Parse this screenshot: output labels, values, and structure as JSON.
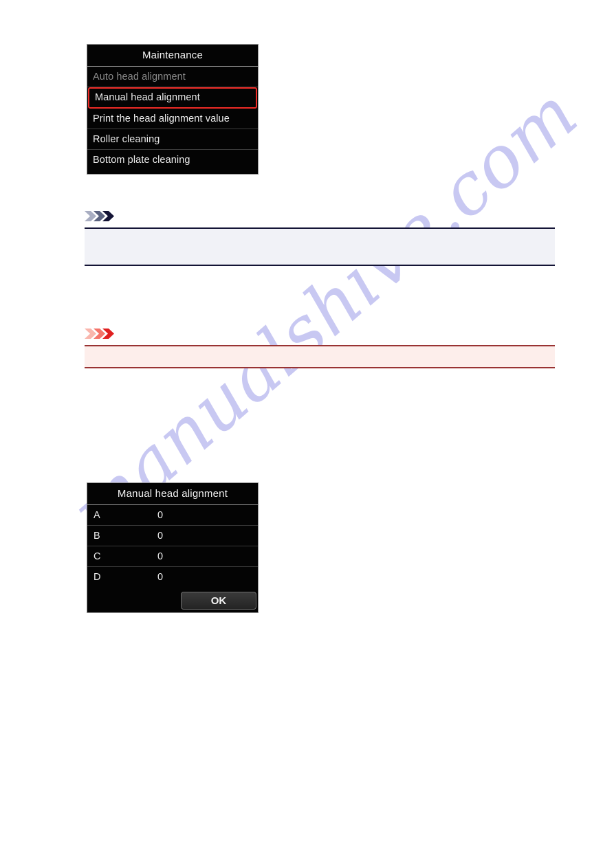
{
  "page": {
    "background_color": "#ffffff",
    "watermark": "manualshive.com",
    "watermark_color": "#c6c6f2"
  },
  "maintenance_screen": {
    "title": "Maintenance",
    "accent_color": "#ef2b26",
    "items": [
      {
        "label": "Auto head alignment",
        "state": "disabled"
      },
      {
        "label": "Manual head alignment",
        "state": "selected"
      },
      {
        "label": "Print the head alignment value",
        "state": "normal"
      },
      {
        "label": "Roller cleaning",
        "state": "normal"
      },
      {
        "label": "Bottom plate cleaning",
        "state": "normal"
      }
    ]
  },
  "note_callout": {
    "icon": "triple-chevron-icon",
    "icon_color": "#141436",
    "body_text": ""
  },
  "caution_callout": {
    "icon": "triple-chevron-icon",
    "icon_color": "#e02020",
    "body_text": ""
  },
  "alignment_screen": {
    "title": "Manual head alignment",
    "rows": [
      {
        "label": "A",
        "value": "0"
      },
      {
        "label": "B",
        "value": "0"
      },
      {
        "label": "C",
        "value": "0"
      },
      {
        "label": "D",
        "value": "0"
      }
    ],
    "ok_label": "OK"
  }
}
